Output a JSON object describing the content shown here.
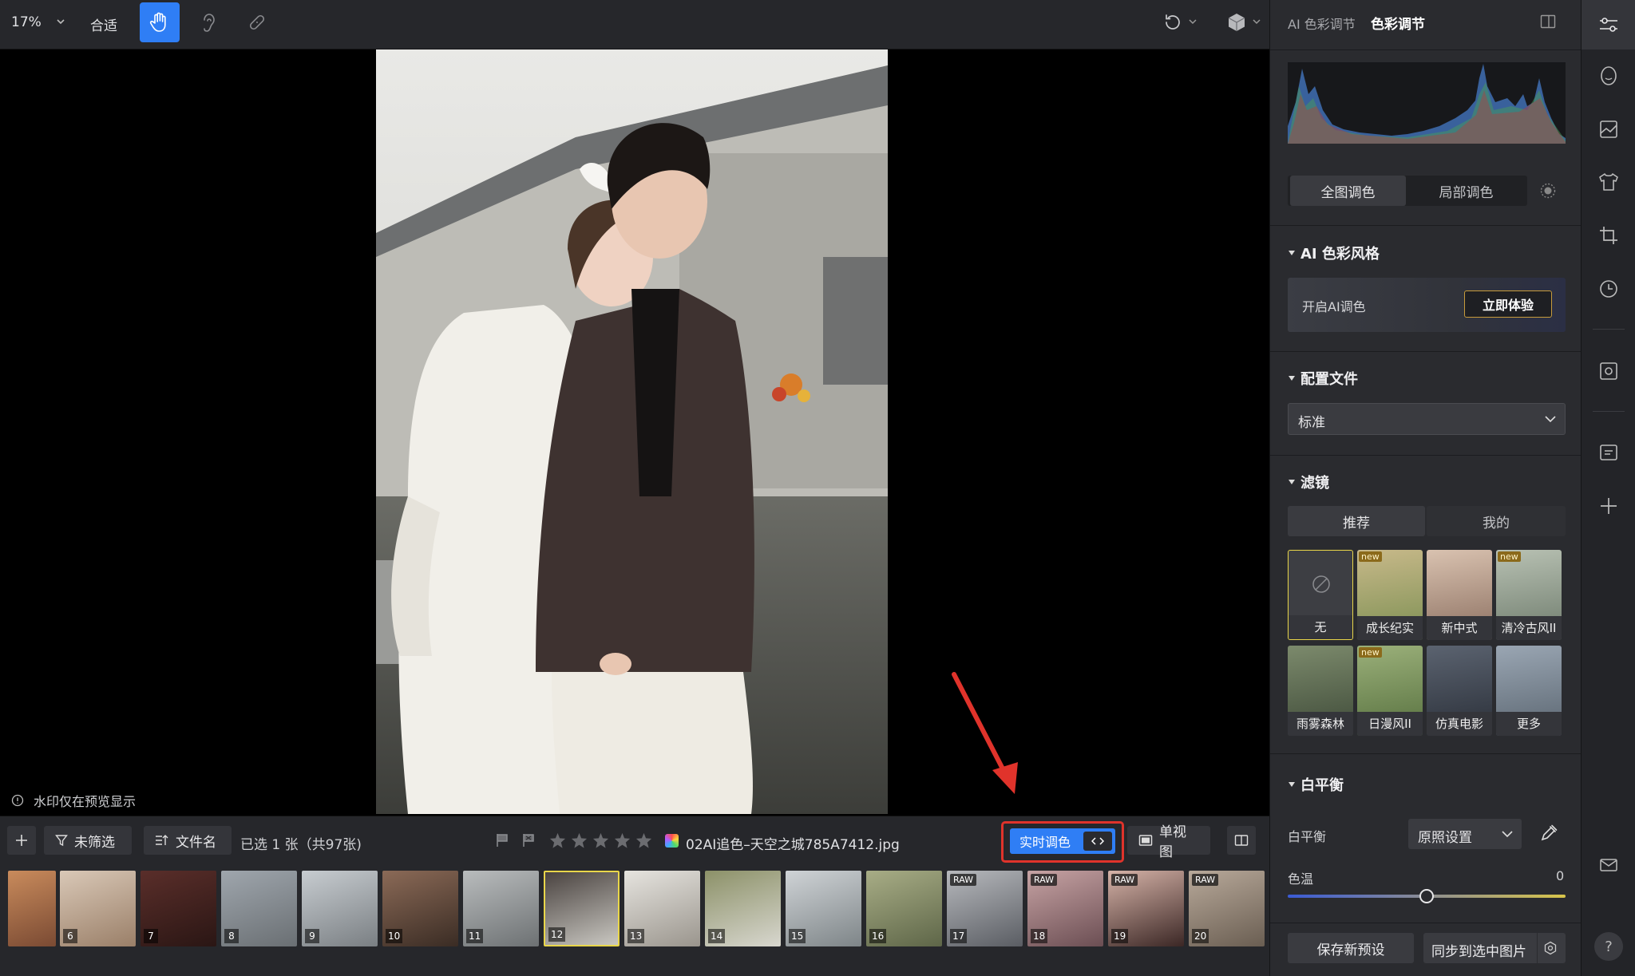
{
  "toolbar": {
    "zoom": "17%",
    "fit_label": "合适",
    "icons": [
      "hand-tool-icon",
      "ear-tool-icon",
      "bandage-tool-icon",
      "undo-icon",
      "cube-icon"
    ]
  },
  "canvas": {
    "watermark_note": "水印仅在预览显示"
  },
  "bottom_bar": {
    "unfiltered_label": "未筛选",
    "filename_sort_label": "文件名",
    "selection_status": "已选 1 张（共97张)",
    "filename": "02AI追色–天空之城785A7412.jpg",
    "rating_stars": 0,
    "realtime_grade_label": "实时调色",
    "single_view_label": "单视图"
  },
  "filmstrip": {
    "thumbs": [
      {
        "num": "",
        "raw": false
      },
      {
        "num": "6",
        "raw": false
      },
      {
        "num": "7",
        "raw": false
      },
      {
        "num": "8",
        "raw": false
      },
      {
        "num": "9",
        "raw": false
      },
      {
        "num": "10",
        "raw": false
      },
      {
        "num": "11",
        "raw": false
      },
      {
        "num": "12",
        "raw": false
      },
      {
        "num": "13",
        "raw": false
      },
      {
        "num": "14",
        "raw": false
      },
      {
        "num": "15",
        "raw": false
      },
      {
        "num": "16",
        "raw": false
      },
      {
        "num": "17",
        "raw": true
      },
      {
        "num": "18",
        "raw": true
      },
      {
        "num": "19",
        "raw": true
      },
      {
        "num": "20",
        "raw": true
      }
    ],
    "raw_tag": "RAW",
    "selected_num": "12"
  },
  "panel": {
    "tab_ai_color": "AI 色彩调节",
    "tab_color": "色彩调节",
    "global_grade": "全图调色",
    "local_grade": "局部调色",
    "ai_style_title": "AI 色彩风格",
    "ai_enable_text": "开启AI调色",
    "ai_try_button": "立即体验",
    "profile_title": "配置文件",
    "profile_value": "标准",
    "filter_title": "滤镜",
    "filter_tab_recommended": "推荐",
    "filter_tab_mine": "我的",
    "filters": [
      {
        "label": "无",
        "new": false
      },
      {
        "label": "成长纪实",
        "new": true
      },
      {
        "label": "新中式",
        "new": false
      },
      {
        "label": "清冷古风II",
        "new": true
      },
      {
        "label": "雨雾森林",
        "new": false
      },
      {
        "label": "日漫风II",
        "new": true
      },
      {
        "label": "仿真电影",
        "new": false
      },
      {
        "label": "更多",
        "new": false
      }
    ],
    "new_tag": "new",
    "wb_title": "白平衡",
    "wb_label": "白平衡",
    "wb_value": "原照设置",
    "temp_label": "色温",
    "temp_value": "0",
    "temp_slider_fraction": 0.5,
    "save_preset": "保存新预设",
    "sync_selected": "同步到选中图片"
  },
  "colors": {
    "accent_blue": "#2f7ef5",
    "highlight_red": "#e0332b",
    "selected_thumb_border": "#e9d64a"
  }
}
